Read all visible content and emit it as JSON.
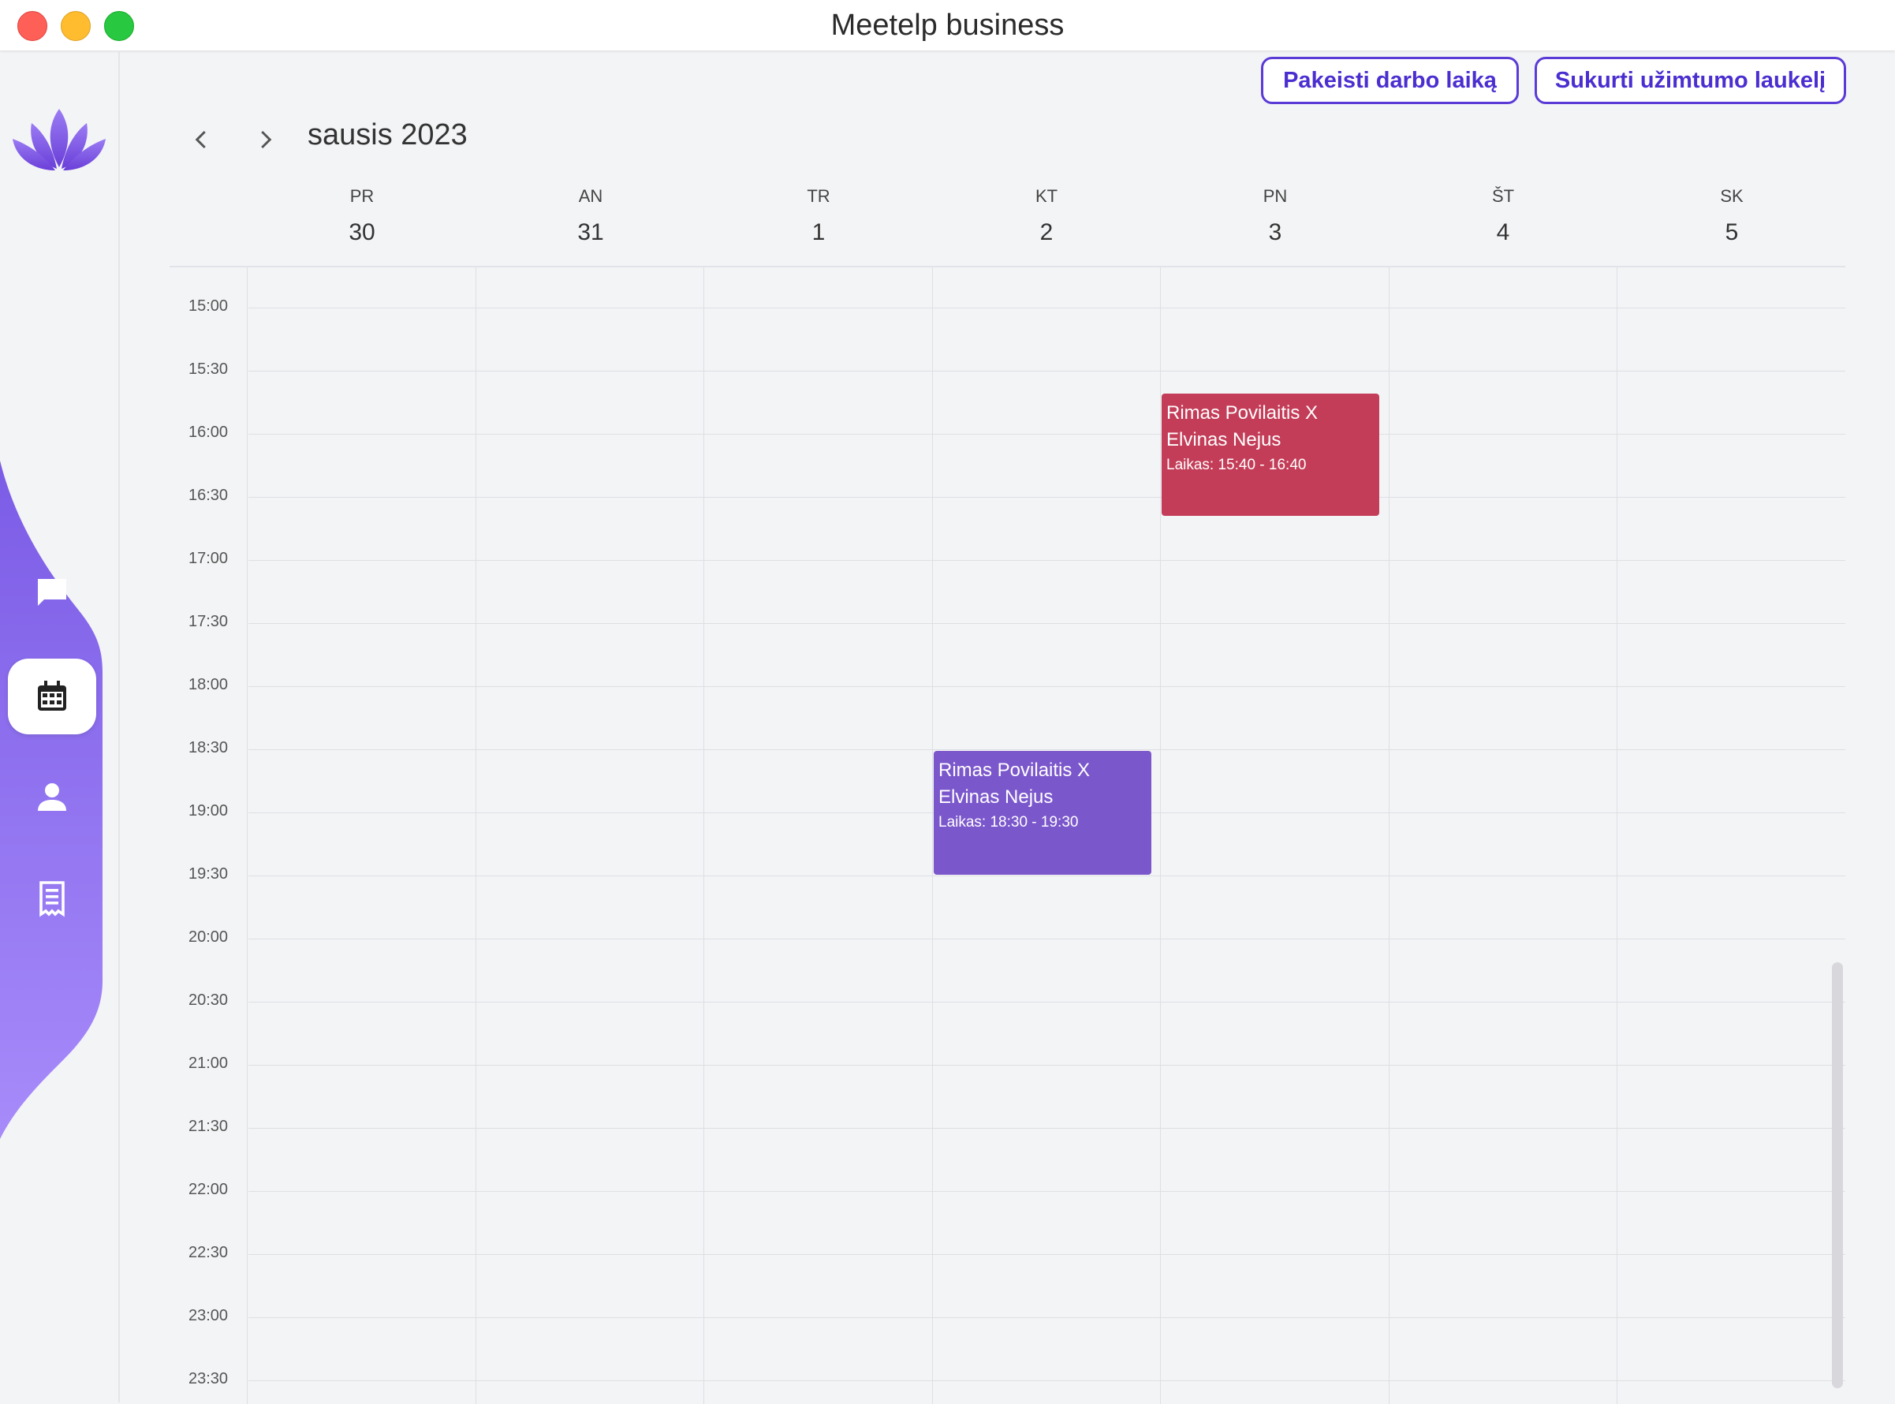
{
  "window": {
    "title": "Meetelp business"
  },
  "toolbar": {
    "change_hours_label": "Pakeisti darbo laiką",
    "create_busy_label": "Sukurti užimtumo laukelį"
  },
  "calendar": {
    "month_label": "sausis 2023",
    "days": [
      {
        "weekday": "PR",
        "date": "30"
      },
      {
        "weekday": "AN",
        "date": "31"
      },
      {
        "weekday": "TR",
        "date": "1"
      },
      {
        "weekday": "KT",
        "date": "2"
      },
      {
        "weekday": "PN",
        "date": "3"
      },
      {
        "weekday": "ŠT",
        "date": "4"
      },
      {
        "weekday": "SK",
        "date": "5"
      }
    ],
    "times": [
      "15:00",
      "15:30",
      "16:00",
      "16:30",
      "17:00",
      "17:30",
      "18:00",
      "18:30",
      "19:00",
      "19:30",
      "20:00",
      "20:30",
      "21:00",
      "21:30",
      "22:00",
      "22:30",
      "23:00",
      "23:30"
    ],
    "events": [
      {
        "title": "Rimas Povilaitis X Elvinas Nejus",
        "time_label": "Laikas: 15:40 - 16:40",
        "color": "#c33d58"
      },
      {
        "title": "Rimas Povilaitis X Elvinas Nejus",
        "time_label": "Laikas: 18:30 - 19:30",
        "color": "#7b57cc"
      }
    ]
  },
  "sidebar": {
    "icons": [
      "lotus-logo-icon",
      "chat-icon",
      "calendar-icon",
      "user-icon",
      "receipt-icon"
    ],
    "accent_color": "#8b6cf0"
  }
}
